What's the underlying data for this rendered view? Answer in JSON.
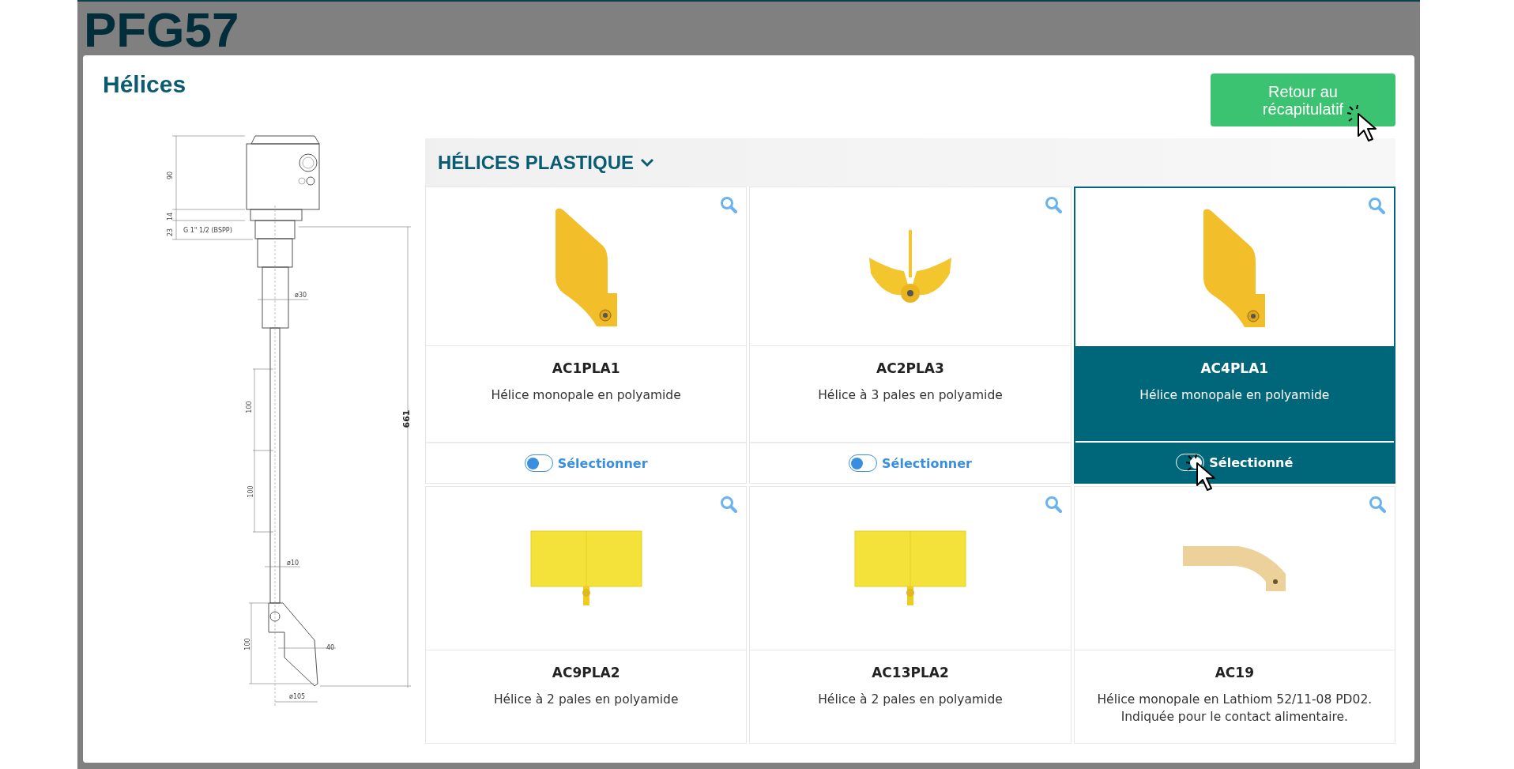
{
  "page": {
    "title": "PFG57"
  },
  "modal": {
    "title": "Hélices",
    "back_button": "Retour au récapitulatif"
  },
  "drawing": {
    "labels": [
      "90",
      "14",
      "23",
      "G 1\" 1/2 (BSPP)",
      "ø30",
      "100",
      "100",
      "661",
      "ø10",
      "100",
      "40",
      "ø105"
    ]
  },
  "section": {
    "title": "HÉLICES PLASTIQUE",
    "expanded": true
  },
  "products": [
    {
      "kind": "single-blade",
      "code": "AC1PLA1",
      "description": "Hélice monopale en polyamide",
      "selected": false,
      "toggle_label": "Sélectionner"
    },
    {
      "kind": "three-blade",
      "code": "AC2PLA3",
      "description": "Hélice à 3 pales en polyamide",
      "selected": false,
      "toggle_label": "Sélectionner"
    },
    {
      "kind": "single-blade",
      "code": "AC4PLA1",
      "description": "Hélice monopale en polyamide",
      "selected": true,
      "toggle_label": "Sélectionné"
    },
    {
      "kind": "two-blade",
      "code": "AC9PLA2",
      "description": "Hélice à 2 pales en polyamide",
      "selected": false
    },
    {
      "kind": "two-blade",
      "code": "AC13PLA2",
      "description": "Hélice à 2 pales en polyamide",
      "selected": false
    },
    {
      "kind": "curved-blade",
      "code": "AC19",
      "description": "Hélice monopale en Lathiom 52/11-08 PD02.\nIndiquée pour le contact alimentaire.",
      "selected": false
    }
  ]
}
